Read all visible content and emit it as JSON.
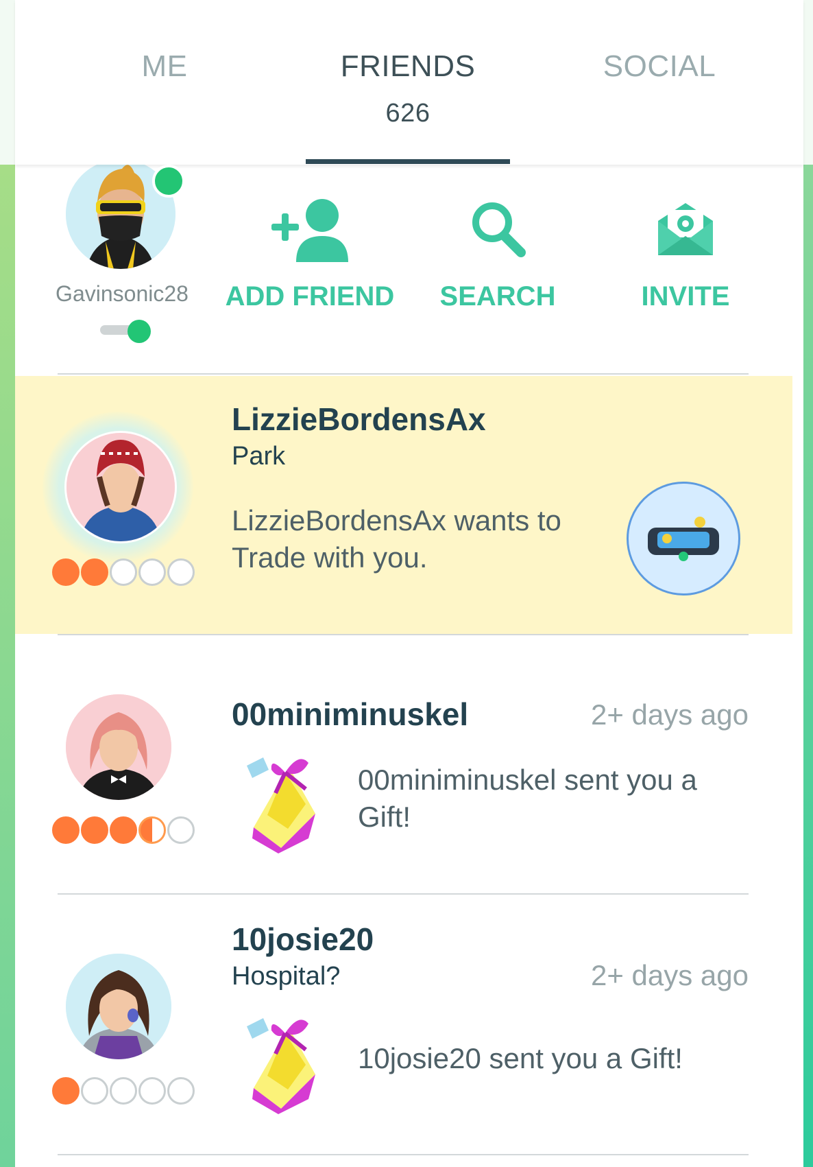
{
  "tabs": {
    "me": "ME",
    "friends": "FRIENDS",
    "friends_count": "626",
    "social": "SOCIAL"
  },
  "me": {
    "username": "Gavinsonic28",
    "status": "online"
  },
  "actions": {
    "add_friend": "ADD FRIEND",
    "search": "SEARCH",
    "invite": "INVITE"
  },
  "friends": [
    {
      "name": "LizzieBordensAx",
      "location": "Park",
      "message": "LizzieBordensAx wants to Trade with you.",
      "hearts_filled": 2,
      "hearts_total": 5
    },
    {
      "name": "00miniminuskel",
      "time": "2+ days ago",
      "message": "00miniminuskel sent you a Gift!",
      "hearts_filled": 3.5,
      "hearts_total": 5
    },
    {
      "name": "10josie20",
      "location": "Hospital?",
      "time": "2+ days ago",
      "message": "10josie20 sent you a Gift!",
      "hearts_filled": 1,
      "hearts_total": 5
    }
  ],
  "colors": {
    "accent": "#3cc6a0",
    "title": "#23424f",
    "highlight": "#fef6c8",
    "heart": "#ff7a39",
    "online": "#22c575"
  }
}
